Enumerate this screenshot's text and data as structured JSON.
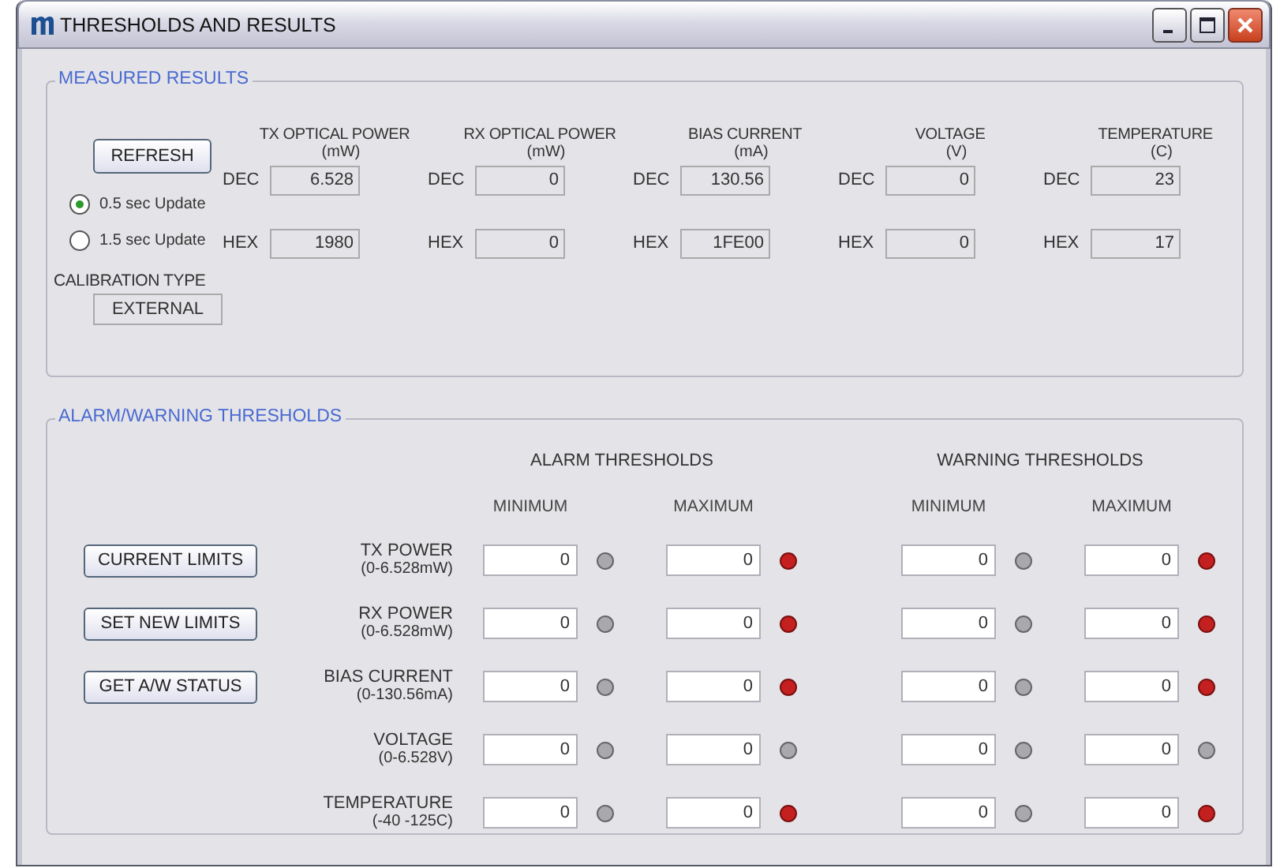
{
  "window": {
    "title": "THRESHOLDS AND RESULTS"
  },
  "measured": {
    "title": "MEASURED RESULTS",
    "refresh": "REFRESH",
    "update_options": [
      {
        "label": "0.5 sec Update",
        "selected": true
      },
      {
        "label": "1.5 sec Update",
        "selected": false
      }
    ],
    "calibration_label": "CALIBRATION TYPE",
    "calibration_value": "EXTERNAL",
    "quantities": [
      {
        "name": "TX OPTICAL POWER",
        "unit": "(mW)",
        "dec_label": "DEC",
        "dec": "6.528",
        "hex_label": "HEX",
        "hex": "1980"
      },
      {
        "name": "RX OPTICAL POWER",
        "unit": "(mW)",
        "dec_label": "DEC",
        "dec": "0",
        "hex_label": "HEX",
        "hex": "0"
      },
      {
        "name": "BIAS CURRENT",
        "unit": "(mA)",
        "dec_label": "DEC",
        "dec": "130.56",
        "hex_label": "HEX",
        "hex": "1FE00"
      },
      {
        "name": "VOLTAGE",
        "unit": "(V)",
        "dec_label": "DEC",
        "dec": "0",
        "hex_label": "HEX",
        "hex": "0"
      },
      {
        "name": "TEMPERATURE",
        "unit": "(C)",
        "dec_label": "DEC",
        "dec": "23",
        "hex_label": "HEX",
        "hex": "17"
      }
    ]
  },
  "thresholds": {
    "title": "ALARM/WARNING THRESHOLDS",
    "buttons": [
      "CURRENT LIMITS",
      "SET NEW LIMITS",
      "GET A/W STATUS"
    ],
    "groups": [
      {
        "title": "ALARM THRESHOLDS",
        "columns": [
          "MINIMUM",
          "MAXIMUM"
        ]
      },
      {
        "title": "WARNING THRESHOLDS",
        "columns": [
          "MINIMUM",
          "MAXIMUM"
        ]
      }
    ],
    "rows": [
      {
        "name": "TX POWER",
        "range": "(0-6.528mW)",
        "values": [
          {
            "value": "0",
            "alarm": false
          },
          {
            "value": "0",
            "alarm": true
          },
          {
            "value": "0",
            "alarm": false
          },
          {
            "value": "0",
            "alarm": true
          }
        ]
      },
      {
        "name": "RX POWER",
        "range": "(0-6.528mW)",
        "values": [
          {
            "value": "0",
            "alarm": false
          },
          {
            "value": "0",
            "alarm": true
          },
          {
            "value": "0",
            "alarm": false
          },
          {
            "value": "0",
            "alarm": true
          }
        ]
      },
      {
        "name": "BIAS CURRENT",
        "range": "(0-130.56mA)",
        "values": [
          {
            "value": "0",
            "alarm": false
          },
          {
            "value": "0",
            "alarm": true
          },
          {
            "value": "0",
            "alarm": false
          },
          {
            "value": "0",
            "alarm": true
          }
        ]
      },
      {
        "name": "VOLTAGE",
        "range": "(0-6.528V)",
        "values": [
          {
            "value": "0",
            "alarm": false
          },
          {
            "value": "0",
            "alarm": false
          },
          {
            "value": "0",
            "alarm": false
          },
          {
            "value": "0",
            "alarm": false
          }
        ]
      },
      {
        "name": "TEMPERATURE",
        "range": "(-40 -125C)",
        "values": [
          {
            "value": "0",
            "alarm": false
          },
          {
            "value": "0",
            "alarm": true
          },
          {
            "value": "0",
            "alarm": false
          },
          {
            "value": "0",
            "alarm": true
          }
        ]
      }
    ]
  }
}
